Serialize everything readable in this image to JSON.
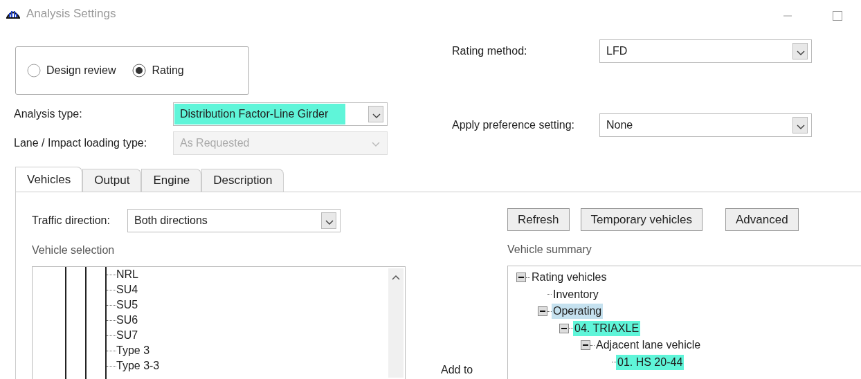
{
  "window": {
    "title": "Analysis Settings"
  },
  "mode": [
    {
      "label": "Design review",
      "selected": false
    },
    {
      "label": "Rating",
      "selected": true
    }
  ],
  "left_fields": [
    {
      "label": "Analysis type:",
      "value": "Distribution Factor-Line Girder",
      "highlighted": true,
      "disabled": false
    },
    {
      "label": "Lane / Impact loading type:",
      "value": "As Requested",
      "highlighted": false,
      "disabled": true
    }
  ],
  "right_fields": [
    {
      "label": "Rating method:",
      "value": "LFD",
      "highlighted": false,
      "disabled": false
    },
    {
      "label": "Apply preference setting:",
      "value": "None",
      "highlighted": false,
      "disabled": false
    }
  ],
  "tabs": [
    {
      "label": "Vehicles",
      "selected": true
    },
    {
      "label": "Output",
      "selected": false
    },
    {
      "label": "Engine",
      "selected": false
    },
    {
      "label": "Description",
      "selected": false
    }
  ],
  "traffic_direction": {
    "label": "Traffic direction:",
    "value": "Both directions"
  },
  "buttons": [
    "Refresh",
    "Temporary vehicles",
    "Advanced"
  ],
  "vehicle_selection": {
    "title": "Vehicle selection",
    "items": [
      "NRL",
      "SU4",
      "SU5",
      "SU6",
      "SU7",
      "Type 3",
      "Type 3-3"
    ]
  },
  "add_to_label": "Add to",
  "vehicle_summary": {
    "title": "Vehicle summary",
    "tree": [
      {
        "label": "Rating vehicles",
        "expanded": true,
        "selected": false,
        "highlighted": false,
        "children": [
          {
            "label": "Inventory",
            "selected": false,
            "highlighted": false
          },
          {
            "label": "Operating",
            "expanded": true,
            "selected": true,
            "highlighted": false,
            "children": [
              {
                "label": "04.  TRIAXLE",
                "expanded": true,
                "selected": false,
                "highlighted": true,
                "children": [
                  {
                    "label": "Adjacent lane vehicle",
                    "expanded": true,
                    "selected": false,
                    "highlighted": false,
                    "children": [
                      {
                        "label": "01.  HS 20-44",
                        "selected": false,
                        "highlighted": true
                      }
                    ]
                  }
                ]
              }
            ]
          }
        ]
      }
    ]
  }
}
